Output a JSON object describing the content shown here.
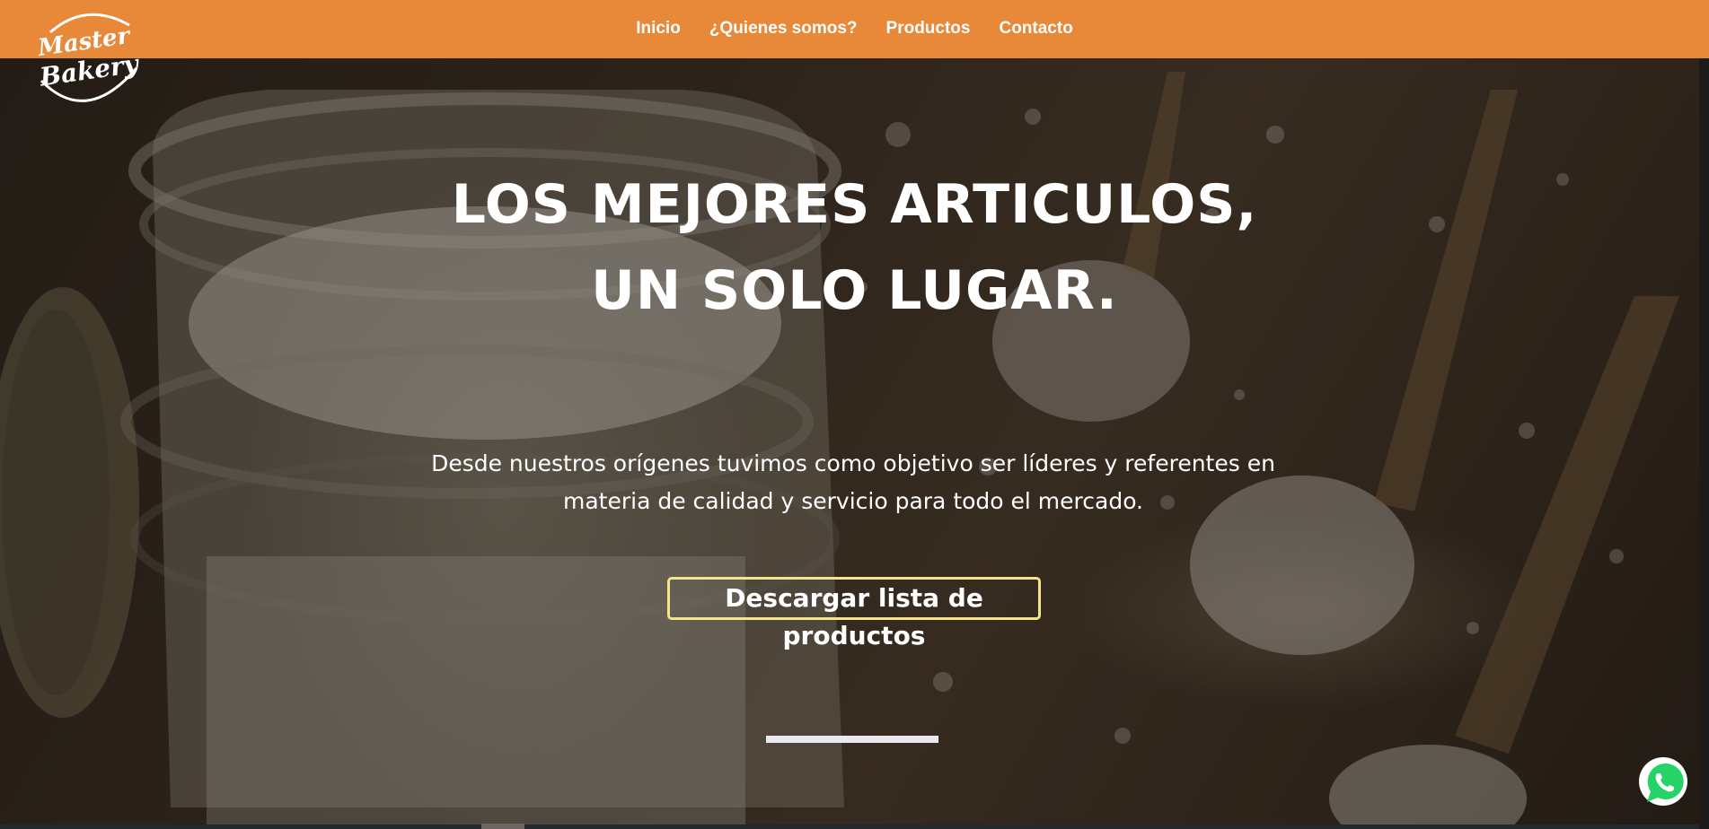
{
  "brand": {
    "logo_line1": "Master",
    "logo_line2": "Bakery"
  },
  "nav": {
    "items": [
      {
        "label": "Inicio"
      },
      {
        "label": "¿Quienes somos?"
      },
      {
        "label": "Productos"
      },
      {
        "label": "Contacto"
      }
    ]
  },
  "hero": {
    "title_line1": "LOS MEJORES ARTICULOS,",
    "title_line2": "UN SOLO LUGAR.",
    "description": "Desde nuestros orígenes tuvimos como objetivo ser líderes y referentes en materia de calidad y servicio para todo el mercado.",
    "cta_label": "Descargar lista de productos"
  },
  "colors": {
    "header": "#e8893a",
    "cta_border": "#f4e48a",
    "whatsapp": "#25d366"
  },
  "icons": {
    "chat_button": "whatsapp-icon"
  }
}
